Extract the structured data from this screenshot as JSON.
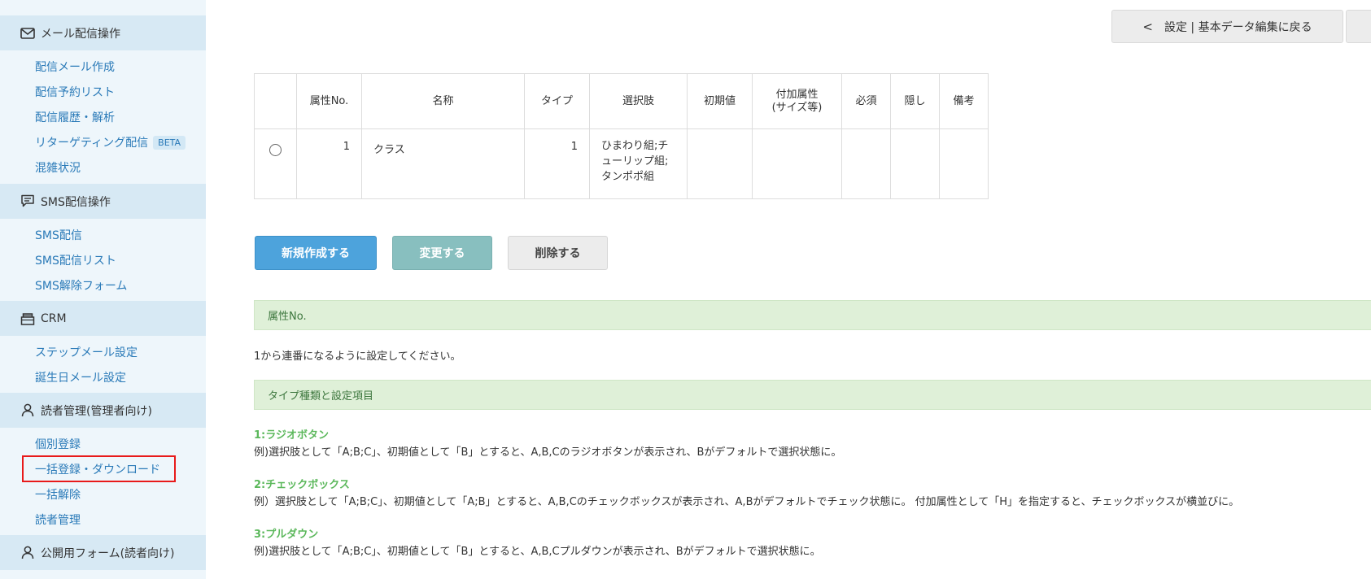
{
  "sidebar": {
    "mail_section": {
      "title": "メール配信操作",
      "icon": "mail-icon",
      "items": [
        "配信メール作成",
        "配信予約リスト",
        "配信履歴・解析",
        "リターゲティング配信",
        "混雑状況"
      ],
      "beta_badge": "BETA"
    },
    "sms_section": {
      "title": "SMS配信操作",
      "icon": "chat-icon",
      "items": [
        "SMS配信",
        "SMS配信リスト",
        "SMS解除フォーム"
      ]
    },
    "crm_section": {
      "title": "CRM",
      "icon": "inbox-icon",
      "items": [
        "ステップメール設定",
        "誕生日メール設定"
      ]
    },
    "reader_section": {
      "title": "読者管理(管理者向け)",
      "icon": "user-icon",
      "items": [
        "個別登録",
        "一括登録・ダウンロード",
        "一括解除",
        "読者管理"
      ]
    },
    "public_form_section": {
      "title": "公開用フォーム(読者向け)",
      "icon": "user-icon"
    }
  },
  "header": {
    "back_label": "設定 | 基本データ編集に戻る"
  },
  "table": {
    "columns": [
      "",
      "属性No.",
      "名称",
      "タイプ",
      "選択肢",
      "初期値",
      "付加属性",
      "(サイズ等)",
      "必須",
      "隠し",
      "備考"
    ],
    "rows": [
      {
        "no": "1",
        "name": "クラス",
        "type": "1",
        "choices_line1": "ひまわり組;チ",
        "choices_line2": "ューリップ組;",
        "choices_line3": "タンポポ組",
        "initial": "",
        "extra": "",
        "required": "",
        "hidden": "",
        "note": ""
      }
    ]
  },
  "buttons": {
    "new": "新規作成する",
    "change": "変更する",
    "delete": "削除する"
  },
  "help": {
    "bar1": "属性No.",
    "text1": "1から連番になるように設定してください。",
    "bar2": "タイプ種類と設定項目",
    "types": [
      {
        "title": "1:ラジオボタン",
        "desc": "例)選択肢として「A;B;C」、初期値として「B」とすると、A,B,Cのラジオボタンが表示され、Bがデフォルトで選択状態に。"
      },
      {
        "title": "2:チェックボックス",
        "desc": "例）選択肢として「A;B;C」、初期値として「A;B」とすると、A,B,Cのチェックボックスが表示され、A,Bがデフォルトでチェック状態に。 付加属性として「H」を指定すると、チェックボックスが横並びに。"
      },
      {
        "title": "3:プルダウン",
        "desc": "例)選択肢として「A;B;C」、初期値として「B」とすると、A,B,Cプルダウンが表示され、Bがデフォルトで選択状態に。"
      }
    ]
  },
  "colors": {
    "sidebar_bg": "#eef6fb",
    "sidebar_header_bg": "#d7e9f4",
    "link": "#2a7ab8",
    "primary": "#4da3dc",
    "success_bg": "#dff0d8",
    "success_text": "#3c763d",
    "type_title": "#5cb85c",
    "highlight": "#e81a1a"
  }
}
